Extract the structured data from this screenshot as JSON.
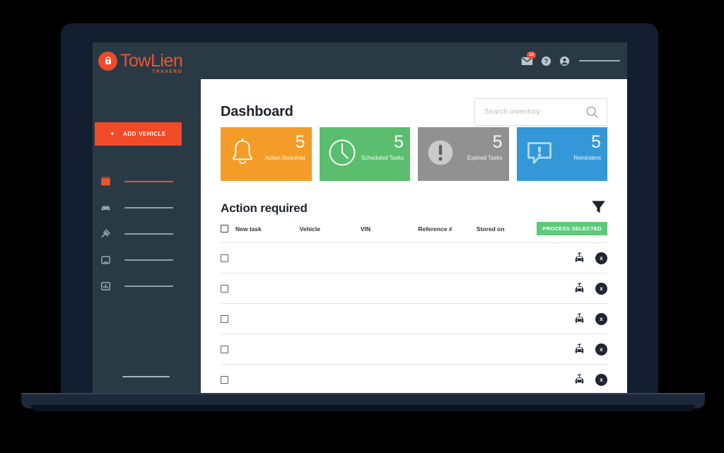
{
  "brand": {
    "name": "TowLien",
    "sub": "TRAXERO",
    "logo_icon": "padlock-icon",
    "accent": "#ee5334"
  },
  "sidebar": {
    "add_vehicle": {
      "label": "ADD VEHICLE",
      "plus": "+",
      "color": "#f04a29"
    },
    "items": [
      {
        "icon": "dashboard-grid-icon",
        "label": "",
        "active": true
      },
      {
        "icon": "car-icon",
        "label": "",
        "active": false
      },
      {
        "icon": "gavel-icon",
        "label": "",
        "active": false
      },
      {
        "icon": "message-box-icon",
        "label": "",
        "active": false
      },
      {
        "icon": "bar-chart-icon",
        "label": "",
        "active": false
      }
    ]
  },
  "topbar": {
    "mail_icon": "envelope-icon",
    "mail_badge": "10",
    "help_icon": "question-mark-icon",
    "user_icon": "user-avatar-icon"
  },
  "header": {
    "title": "Dashboard"
  },
  "search": {
    "placeholder": "Search inventory",
    "value": "",
    "icon": "search-icon"
  },
  "cards": [
    {
      "value": "5",
      "label": "Action Required",
      "color": "#f39c28",
      "icon": "bell-icon"
    },
    {
      "value": "5",
      "label": "Scheduled Tasks",
      "color": "#5bbd6e",
      "icon": "clock-icon"
    },
    {
      "value": "5",
      "label": "Expired Tasks",
      "color": "#919191",
      "icon": "exclamation-circle-icon"
    },
    {
      "value": "5",
      "label": "Reminders",
      "color": "#3498d8",
      "icon": "speech-bubble-alert-icon"
    }
  ],
  "table": {
    "section_title": "Action required",
    "filter_icon": "funnel-filter-icon",
    "columns": [
      "New task",
      "Vehicle",
      "VIN",
      "Reference #",
      "Stored on"
    ],
    "process_button": "PROCESS SELECTED",
    "row_count": 5,
    "row_action_icons": [
      "tow-truck-icon",
      "remove-x-icon"
    ],
    "remove_glyph": "x"
  }
}
